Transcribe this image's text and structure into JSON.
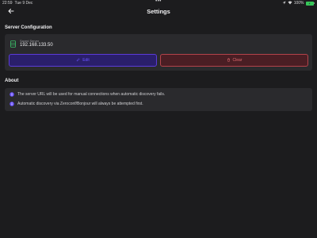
{
  "statusbar": {
    "time": "22:59",
    "date": "Tue 9 Dec",
    "battery": "100%"
  },
  "header": {
    "title": "Settings",
    "back_icon": "arrow-left-icon"
  },
  "server_section": {
    "title": "Server Configuration",
    "saved_label": "Saved Server",
    "saved_value": "192.168.133.50",
    "edit_label": "Edit",
    "clear_label": "Clear"
  },
  "about_section": {
    "title": "About",
    "items": [
      {
        "icon": "info-icon",
        "text": "The server URL will be used for manual connections when automatic discovery fails."
      },
      {
        "icon": "info-icon",
        "text": "Automatic discovery via Zeroconf/Bonjour will always be attempted first."
      }
    ]
  },
  "colors": {
    "background": "#1c1c1e",
    "card": "#2a2a2d",
    "accent_purple": "#6a52ff",
    "danger_red": "#e06a6f",
    "server_green": "#3cc36a"
  }
}
